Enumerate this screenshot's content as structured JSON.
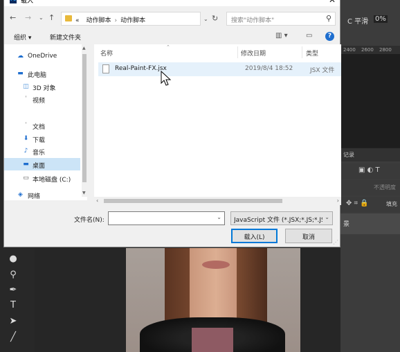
{
  "dialog": {
    "title": "载入",
    "address": {
      "overflow": "«",
      "crumbs": [
        "动作脚本",
        "动作脚本"
      ]
    },
    "search_placeholder": "搜索\"动作脚本\"",
    "toolbar": {
      "organize": "组织 ▾",
      "new_folder": "新建文件夹"
    },
    "nav": [
      {
        "icon": "cloud-icon",
        "label": "OneDrive"
      },
      {
        "icon": "computer-icon",
        "label": "此电脑"
      },
      {
        "icon": "cube-icon",
        "label": "3D 对象"
      },
      {
        "icon": "video-icon",
        "label": "视频"
      },
      {
        "icon": "document-icon",
        "label": "文档"
      },
      {
        "icon": "download-icon",
        "label": "下载"
      },
      {
        "icon": "music-icon",
        "label": "音乐"
      },
      {
        "icon": "desktop-icon",
        "label": "桌面"
      },
      {
        "icon": "drive-icon",
        "label": "本地磁盘 (C:)"
      },
      {
        "icon": "network-icon",
        "label": "网络"
      }
    ],
    "columns": {
      "name": "名称",
      "date": "修改日期",
      "type": "类型"
    },
    "files": [
      {
        "name": "Real-Paint-FX.jsx",
        "date": "2019/8/4 18:52",
        "type": "JSX 文件"
      }
    ],
    "filename_label": "文件名(N):",
    "filename_value": "",
    "filter": "JavaScript 文件 (*.JSX;*.JS;*.JS",
    "open_button": "载入(L)",
    "cancel_button": "取消"
  },
  "photoshop": {
    "options_text": "C 平滑",
    "options_pct": "0%",
    "ruler": [
      "2400",
      "2600",
      "2800"
    ],
    "panel_tab": "记录",
    "opacity_label": "不透明度",
    "fill_label": "填充",
    "layer_label": "景"
  }
}
